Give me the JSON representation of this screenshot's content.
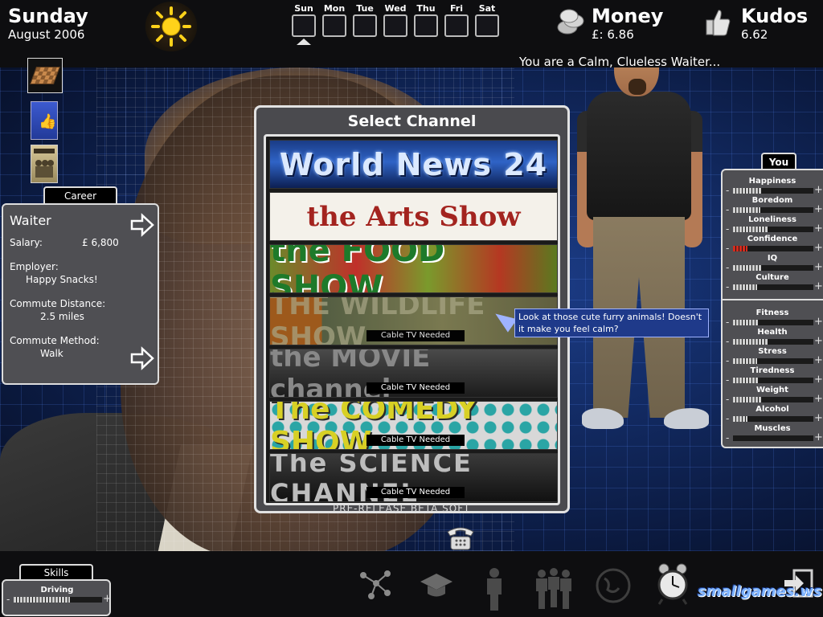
{
  "header": {
    "day": "Sunday",
    "month": "August 2006",
    "weather_icon": "sun-icon",
    "weekdays": [
      "Sun",
      "Mon",
      "Tue",
      "Wed",
      "Thu",
      "Fri",
      "Sat"
    ],
    "current_day": "Sun",
    "money_title": "Money",
    "money_value": "£: 6.86",
    "kudos_title": "Kudos",
    "kudos_value": "6.62",
    "status": "You are a Calm, Clueless Waiter..."
  },
  "inventory": [
    "chessboard-icon",
    "book-thumbs-icon",
    "book-band-icon"
  ],
  "career": {
    "tab": "Career",
    "title": "Waiter",
    "salary_label": "Salary:",
    "salary_value": "£ 6,800",
    "employer_label": "Employer:",
    "employer_value": "Happy Snacks!",
    "commute_distance_label": "Commute Distance:",
    "commute_distance_value": "2.5 miles",
    "commute_method_label": "Commute Method:",
    "commute_method_value": "Walk"
  },
  "channel_dialog": {
    "title": "Select Channel",
    "channels": [
      {
        "name": "World News 24",
        "needed": ""
      },
      {
        "name": "the Arts Show",
        "needed": ""
      },
      {
        "name": "the FOOD SHOW",
        "needed": ""
      },
      {
        "name": "THE WILDLIFE SHOW",
        "needed": "Cable TV Needed"
      },
      {
        "name": "the MOVIE channel",
        "needed": "Cable TV Needed"
      },
      {
        "name": "The COMEDY SHOW",
        "needed": "Cable TV Needed"
      },
      {
        "name": "The SCIENCE CHANNEL",
        "needed": "Cable TV Needed"
      }
    ]
  },
  "tooltip": "Look at those cute furry animals! Doesn't it make you feel calm?",
  "you": {
    "tab": "You",
    "stats": [
      {
        "name": "Happiness",
        "level": 0.36
      },
      {
        "name": "Boredom",
        "level": 0.34
      },
      {
        "name": "Loneliness",
        "level": 0.44
      },
      {
        "name": "Confidence",
        "level": 0.18,
        "warning": true
      },
      {
        "name": "IQ",
        "level": 0.36
      },
      {
        "name": "Culture",
        "level": 0.3
      },
      {
        "name": "Fitness",
        "level": 0.32
      },
      {
        "name": "Health",
        "level": 0.44
      },
      {
        "name": "Stress",
        "level": 0.3
      },
      {
        "name": "Tiredness",
        "level": 0.32
      },
      {
        "name": "Weight",
        "level": 0.36
      },
      {
        "name": "Alcohol",
        "level": 0.18
      },
      {
        "name": "Muscles",
        "level": 0.0
      }
    ]
  },
  "watermark": "PRE-RELEASE BETA SOFT",
  "skills": {
    "tab": "Skills",
    "items": [
      {
        "name": "Driving",
        "level": 0.64
      }
    ]
  },
  "bottom_icons": [
    "network-icon",
    "graduation-cap-icon",
    "person-icon",
    "group-icon",
    "globe-icon",
    "alarm-clock-icon",
    "exit-icon"
  ],
  "site_logo": "smallgames.ws"
}
